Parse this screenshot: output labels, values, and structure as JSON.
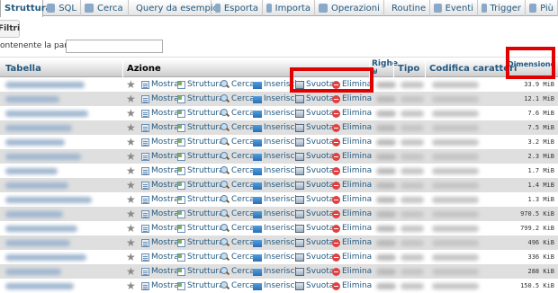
{
  "tabs": [
    {
      "label": "Struttura",
      "icon": "structure-icon",
      "active": true
    },
    {
      "label": "SQL",
      "icon": "sql-icon"
    },
    {
      "label": "Cerca",
      "icon": "search-icon"
    },
    {
      "label": "Query da esempio",
      "icon": "query-icon"
    },
    {
      "label": "Esporta",
      "icon": "export-icon"
    },
    {
      "label": "Importa",
      "icon": "import-icon"
    },
    {
      "label": "Operazioni",
      "icon": "wrench-icon"
    },
    {
      "label": "Routine",
      "icon": "routine-icon"
    },
    {
      "label": "Eventi",
      "icon": "clock-icon"
    },
    {
      "label": "Trigger",
      "icon": "trigger-icon"
    },
    {
      "label": "Più",
      "icon": "chevron-down-icon"
    }
  ],
  "filter": {
    "legend": "Filtri",
    "label": "ontenente la parola:",
    "value": ""
  },
  "columns": {
    "tabella": "Tabella",
    "azione": "Azione",
    "righe_1": "Righe",
    "righe_2": "⊌",
    "tipo": "Tipo",
    "codifica": "Codifica caratteri",
    "dimensione_1": "Dimensione",
    "dimensione_2": "▾"
  },
  "actions": {
    "mostra": "Mostra",
    "struttura": "Struttura",
    "cerca": "Cerca",
    "inserisci": "Inserisci",
    "svuota": "Svuota",
    "elimina": "Elimina"
  },
  "rows": [
    {
      "size": "33.9 MiB"
    },
    {
      "size": "12.1 MiB"
    },
    {
      "size": "7.6 MiB"
    },
    {
      "size": "7.5 MiB"
    },
    {
      "size": "3.2 MiB"
    },
    {
      "size": "2.3 MiB"
    },
    {
      "size": "1.7 MiB"
    },
    {
      "size": "1.4 MiB"
    },
    {
      "size": "1.3 MiB"
    },
    {
      "size": "970.5 KiB"
    },
    {
      "size": "799.2 KiB"
    },
    {
      "size": "496 KiB"
    },
    {
      "size": "336 KiB"
    },
    {
      "size": "288 KiB"
    },
    {
      "size": "150.5 KiB"
    }
  ],
  "colors": {
    "link": "#235a81",
    "highlight": "#e00000",
    "row_alt": "#dfdfdf"
  }
}
